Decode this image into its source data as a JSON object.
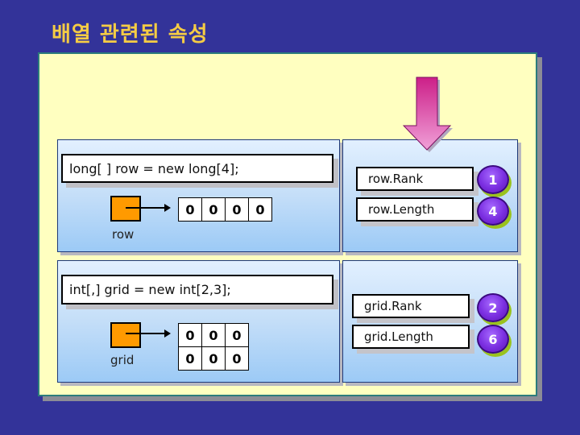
{
  "title": "배열 관련된 속성",
  "colors": {
    "background": "#333399",
    "title": "#f5cc44",
    "frame": "#ffffc0",
    "reference_box": "#ff9a00",
    "badge": "#7a2ee0",
    "arrow": "#d8409c"
  },
  "row_example": {
    "code": "long[ ] row = new long[4];",
    "variable_label": "row",
    "values": [
      "0",
      "0",
      "0",
      "0"
    ],
    "properties": [
      {
        "label": "row.Rank",
        "value": "1"
      },
      {
        "label": "row.Length",
        "value": "4"
      }
    ]
  },
  "grid_example": {
    "code": "int[,] grid = new int[2,3];",
    "variable_label": "grid",
    "values": [
      [
        "0",
        "0",
        "0"
      ],
      [
        "0",
        "0",
        "0"
      ]
    ],
    "properties": [
      {
        "label": "grid.Rank",
        "value": "2"
      },
      {
        "label": "grid.Length",
        "value": "6"
      }
    ]
  }
}
